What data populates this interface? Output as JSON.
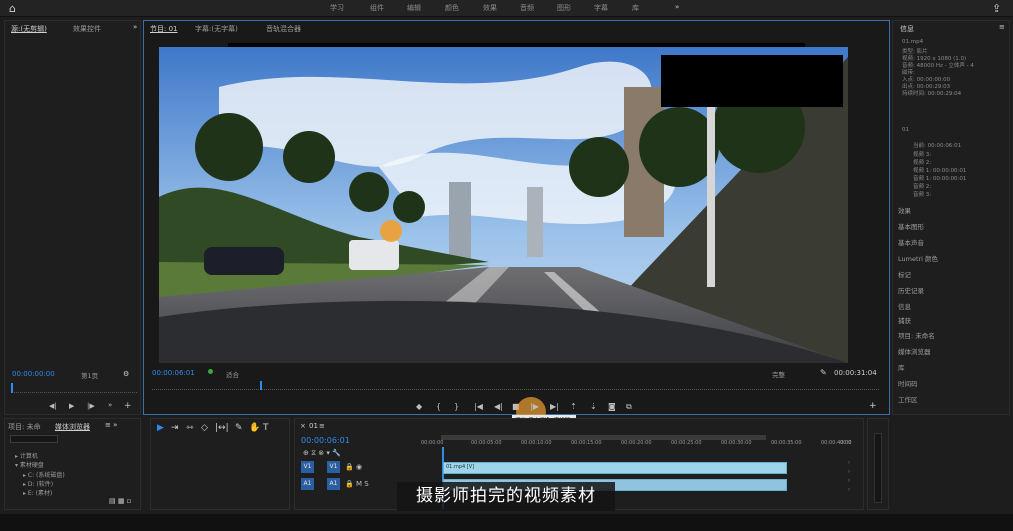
{
  "topbar": {
    "workspaces": [
      "学习",
      "组件",
      "编辑",
      "颜色",
      "效果",
      "音频",
      "图形",
      "字幕",
      "库"
    ]
  },
  "source_panel": {
    "tabs": [
      "源:(无剪辑)",
      "效果控件"
    ],
    "timecode": "00:00:00:00",
    "page": "第1页"
  },
  "program_panel": {
    "tabs": [
      "节目: 01",
      "字幕:(无字幕)",
      "音轨混合器"
    ],
    "timecode_left": "00:00:06:01",
    "fit": "适合",
    "quality": "完整",
    "timecode_right": "00:00:31:04",
    "tooltip": "播放-停止切换 (空格键)"
  },
  "info_panel": {
    "title": "信息",
    "clip_name": "01.mp4",
    "meta": [
      [
        "类型:",
        "影片"
      ],
      [
        "视频:",
        "1920 x 1080 (1.0)"
      ],
      [
        "音频:",
        "48000 Hz - 立体声 - 4"
      ],
      [
        "磁带:",
        ""
      ],
      [
        "入点:",
        "00:00:00:00"
      ],
      [
        "出点:",
        "00:00:29:03"
      ],
      [
        "持续时间:",
        "00:00:29:04"
      ]
    ],
    "seq_title": "01",
    "seq_meta": [
      [
        "当前:",
        "00:00:06:01"
      ],
      [
        "视频 3:",
        ""
      ],
      [
        "视频 2:",
        ""
      ],
      [
        "视频 1:",
        "00:00:00:01"
      ],
      [
        "音频 1:",
        "00:00:00:01"
      ],
      [
        "音频 2:",
        ""
      ],
      [
        "音频 3:",
        ""
      ]
    ],
    "panels": [
      "效果",
      "基本图形",
      "基本声音",
      "Lumetri 颜色",
      "标记",
      "历史记录",
      "信息",
      "捕获",
      "项目: 未命名",
      "媒体浏览器",
      "库",
      "时间码",
      "工作区"
    ]
  },
  "project_panel": {
    "tabs": [
      "项目: 未命",
      "媒体浏览器"
    ],
    "tree": [
      "计算机",
      "素材硬盘",
      "C: (系统磁盘)",
      "D: (软件)",
      "E: (素材)"
    ]
  },
  "timeline": {
    "sequence": "01",
    "timecode": "00:00:06:01",
    "ruler": [
      "00:00:00",
      "00:00:05:00",
      "00:00:10:00",
      "00:00:15:00",
      "00:00:20:00",
      "00:00:25:00",
      "00:00:30:00",
      "00:00:35:00",
      "00:00:40:00",
      "00:0"
    ],
    "tracks": [
      "V1",
      "A1"
    ],
    "track_targets": [
      "V1",
      "A1"
    ],
    "clip_name": "01.mp4 [V]"
  },
  "video": {
    "caption": "摄影师拍完的视频素材"
  }
}
